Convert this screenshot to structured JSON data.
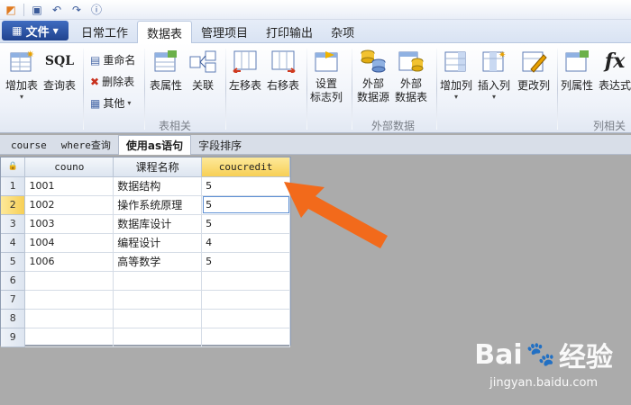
{
  "quick_access": {
    "icons": [
      "app-icon",
      "save-icon",
      "undo-icon",
      "redo-icon",
      "help-icon"
    ]
  },
  "ribbon_tabs": {
    "file_label": "文件",
    "tabs": [
      "日常工作",
      "数据表",
      "管理项目",
      "打印输出",
      "杂项"
    ],
    "active": "数据表"
  },
  "ribbon": {
    "add_table": "增加表",
    "query_table": "查询表",
    "rename": "重命名",
    "delete_table": "删除表",
    "other": "其他",
    "table_props": "表属性",
    "relations": "关联",
    "move_left": "左移表",
    "move_right": "右移表",
    "set_flag_col_1": "设置",
    "set_flag_col_2": "标志列",
    "ext_source_1": "外部",
    "ext_source_2": "数据源",
    "ext_table_1": "外部",
    "ext_table_2": "数据表",
    "add_col": "增加列",
    "insert_col": "插入列",
    "change_col": "更改列",
    "col_props": "列属性",
    "expression": "表达式",
    "sql_icon_text": "SQL",
    "fx_icon_text": "fx",
    "group_table": "表相关",
    "group_external": "外部数据",
    "group_column": "列相关"
  },
  "doc_tabs": [
    "course",
    "where查询",
    "使用as语句",
    "字段排序"
  ],
  "active_doc_tab": "使用as语句",
  "grid": {
    "headers": [
      "couno",
      "课程名称",
      "coucredit"
    ],
    "row_numbers": [
      "1",
      "2",
      "3",
      "4",
      "5",
      "6",
      "7",
      "8",
      "9"
    ],
    "rows": [
      [
        "1001",
        "数据结构",
        "5"
      ],
      [
        "1002",
        "操作系统原理",
        "5"
      ],
      [
        "1003",
        "数据库设计",
        "5"
      ],
      [
        "1004",
        "编程设计",
        "4"
      ],
      [
        "1006",
        "高等数学",
        "5"
      ],
      [
        "",
        "",
        ""
      ],
      [
        "",
        "",
        ""
      ],
      [
        "",
        "",
        ""
      ],
      [
        "",
        "",
        ""
      ]
    ],
    "selected_column": "coucredit",
    "selected_row": "2"
  },
  "colors": {
    "accent": "#2b4f9e",
    "selection": "#f7cf55",
    "arrow": "#f26a1b",
    "background": "#ababab"
  },
  "watermark": {
    "logo_text": "Bai",
    "logo_text_2": "经验",
    "url": "jingyan.baidu.com"
  }
}
